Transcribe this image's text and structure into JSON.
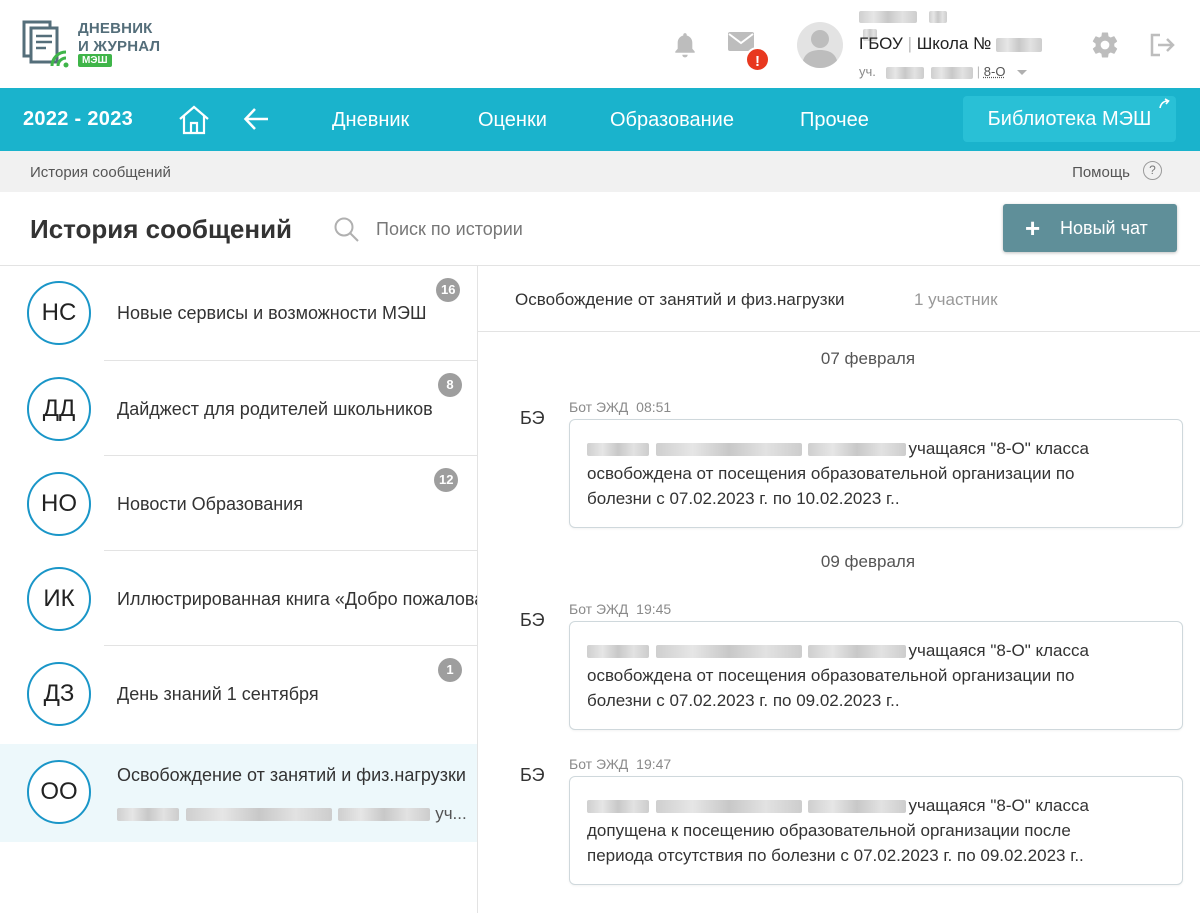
{
  "header": {
    "logo_line1": "ДНЕВНИК",
    "logo_line2": "И ЖУРНАЛ",
    "logo_tag": "МЭШ",
    "mail_alert": "!",
    "school_prefix": "ГБОУ",
    "school_text": "Школа №",
    "role_prefix": "уч.",
    "class_label": "8-О",
    "icons": {
      "bell": "bell-icon",
      "mail": "mail-icon",
      "settings": "gear-icon",
      "logout": "logout-icon"
    }
  },
  "nav": {
    "year": "2022 - 2023",
    "links": [
      "Дневник",
      "Оценки",
      "Образование",
      "Прочее"
    ],
    "library": "Библиотека МЭШ",
    "color": "#1ab3cc"
  },
  "breadcrumb": {
    "current": "История сообщений",
    "help": "Помощь",
    "help_icon": "?"
  },
  "page": {
    "title": "История сообщений",
    "search_placeholder": "Поиск по истории",
    "new_chat": "Новый чат",
    "new_chat_plus": "+"
  },
  "chats": [
    {
      "initials": "НС",
      "title": "Новые сервисы и возможности МЭШ",
      "count": "16"
    },
    {
      "initials": "ДД",
      "title": "Дайджест для родителей школьников",
      "count": "8"
    },
    {
      "initials": "НО",
      "title": "Новости Образования",
      "count": "12"
    },
    {
      "initials": "ИК",
      "title": "Иллюстрированная книга «Добро пожаловать",
      "count": ""
    },
    {
      "initials": "ДЗ",
      "title": "День знаний 1 сентября",
      "count": "1"
    },
    {
      "initials": "ОО",
      "title": "Освобождение от занятий и физ.нагрузки",
      "count": "",
      "preview_tail": "уч..."
    }
  ],
  "conversation": {
    "title": "Освобождение от занятий и физ.нагрузки",
    "members": "1 участник",
    "dates": [
      "07 февраля",
      "09 февраля"
    ],
    "messages": [
      {
        "sender": "БЭ",
        "author": "Бот ЭЖД",
        "time": "08:51",
        "line1_tail": "учащаяся \"8-О\" класса",
        "line2": "освобождена от посещения образовательной организации по",
        "line3": "болезни с 07.02.2023 г. по 10.02.2023 г.."
      },
      {
        "sender": "БЭ",
        "author": "Бот ЭЖД",
        "time": "19:45",
        "line1_tail": "учащаяся \"8-О\" класса",
        "line2": "освобождена от посещения образовательной организации по",
        "line3": "болезни с 07.02.2023 г. по 09.02.2023 г.."
      },
      {
        "sender": "БЭ",
        "author": "Бот ЭЖД",
        "time": "19:47",
        "line1_tail": "учащаяся \"8-О\" класса",
        "line2": "допущена к посещению образовательной организации после",
        "line3": "периода отсутствия по болезни с 07.02.2023 г. по 09.02.2023 г.."
      }
    ]
  }
}
